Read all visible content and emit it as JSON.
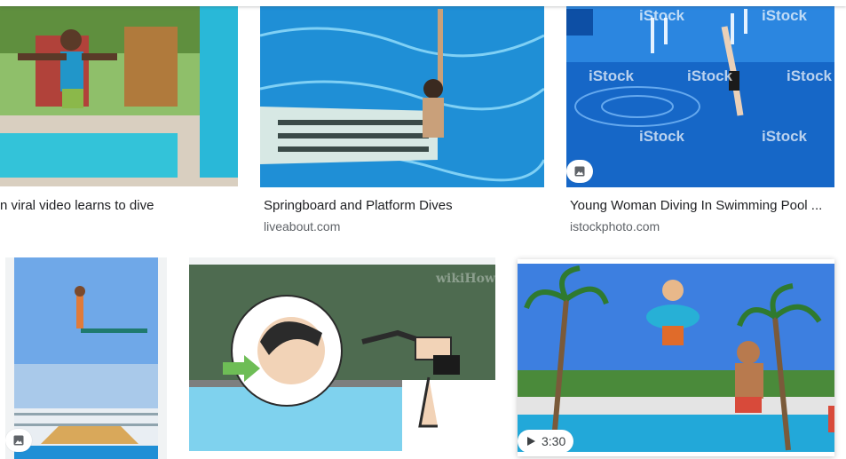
{
  "results": [
    {
      "title": "n viral video learns to dive"
    },
    {
      "title": "Springboard and Platform Dives",
      "source": "liveabout.com"
    },
    {
      "title": "Young Woman Diving In Swimming Pool ...",
      "source": "istockphoto.com",
      "watermark": "iStock",
      "badge_icon": "image-icon"
    },
    {
      "badge_icon": "image-icon"
    },
    {
      "watermark": "wikiHow"
    },
    {
      "badge_icon": "play-icon",
      "duration": "3:30"
    }
  ],
  "colors": {
    "pool_blue": "#1f8fd6",
    "sky": "#6fa8e8",
    "text": "#202124",
    "source": "#5f6368"
  }
}
